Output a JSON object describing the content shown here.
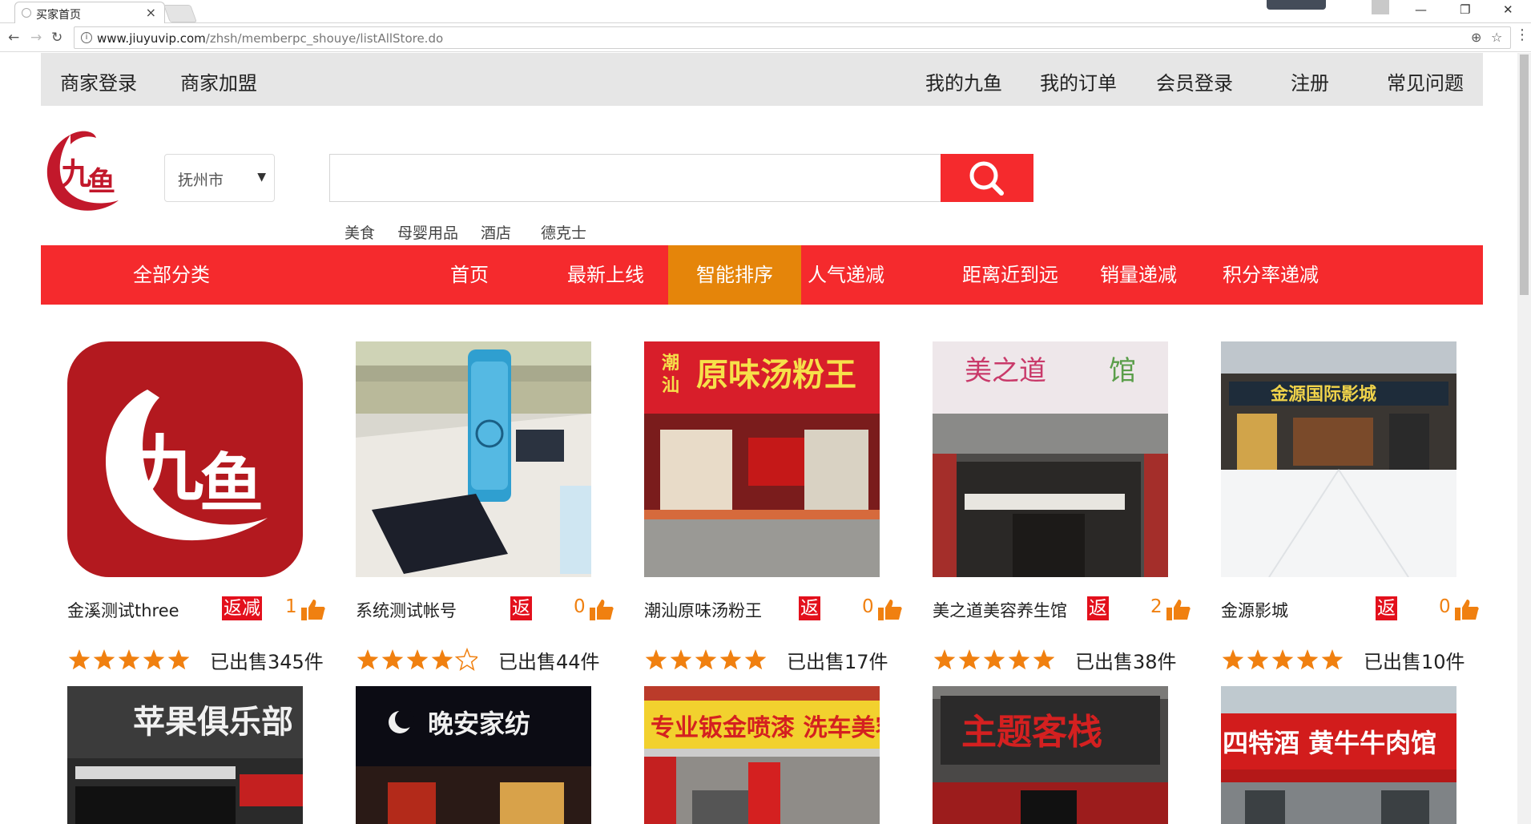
{
  "browser": {
    "tab_title": "买家首页",
    "url_host": "www.jiuyuvip.com",
    "url_path": "/zhsh/memberpc_shouye/listAllStore.do"
  },
  "topnav": {
    "left": [
      "商家登录",
      "商家加盟"
    ],
    "right": [
      "我的九鱼",
      "我的订单",
      "会员登录",
      "注册",
      "常见问题"
    ]
  },
  "search": {
    "city": "抚州市",
    "value": "",
    "hot_tags": [
      "美食",
      "母婴用品",
      "酒店",
      "德克士"
    ]
  },
  "categories": {
    "all": "全部分类",
    "items": [
      "首页",
      "最新上线",
      "智能排序",
      "人气递减",
      "距离近到远",
      "销量递减",
      "积分率递减"
    ],
    "active": "智能排序"
  },
  "colors": {
    "brand_red": "#f52a2d",
    "active_orange": "#e5850a",
    "star_orange": "#f08010"
  },
  "stores": [
    {
      "name": "金溪测试three",
      "badge": "返减",
      "likes": "1",
      "rating": 5,
      "sold": "已出售345件",
      "image": "jiuyu-logo"
    },
    {
      "name": "系统测试帐号",
      "badge": "返",
      "likes": "0",
      "rating": 4,
      "sold": "已出售44件",
      "image": "desk-bottle-photo"
    },
    {
      "name": "潮汕原味汤粉王",
      "badge": "返",
      "likes": "0",
      "rating": 5,
      "sold": "已出售17件",
      "image": "noodle-shop-photo",
      "sign_text": "潮汕 原味汤粉王"
    },
    {
      "name": "美之道美容养生馆",
      "badge": "返",
      "likes": "2",
      "rating": 5,
      "sold": "已出售38件",
      "image": "beauty-salon-photo",
      "sign_text": "美之道 馆"
    },
    {
      "name": "金源影城",
      "badge": "返",
      "likes": "0",
      "rating": 5,
      "sold": "已出售10件",
      "image": "cinema-photo",
      "sign_text": "金源国际影城"
    }
  ],
  "stores_row2": [
    {
      "sign_text": "苹果俱乐部",
      "image": "apple-store-photo"
    },
    {
      "sign_text": "晚安家纺",
      "image": "textile-store-photo"
    },
    {
      "sign_text": "专业钣金喷漆 洗车美容",
      "image": "car-wash-photo"
    },
    {
      "sign_text": "主题客栈",
      "image": "hotel-photo"
    },
    {
      "sign_text": "四特酒 黄牛牛肉馆",
      "image": "beef-restaurant-photo"
    }
  ]
}
